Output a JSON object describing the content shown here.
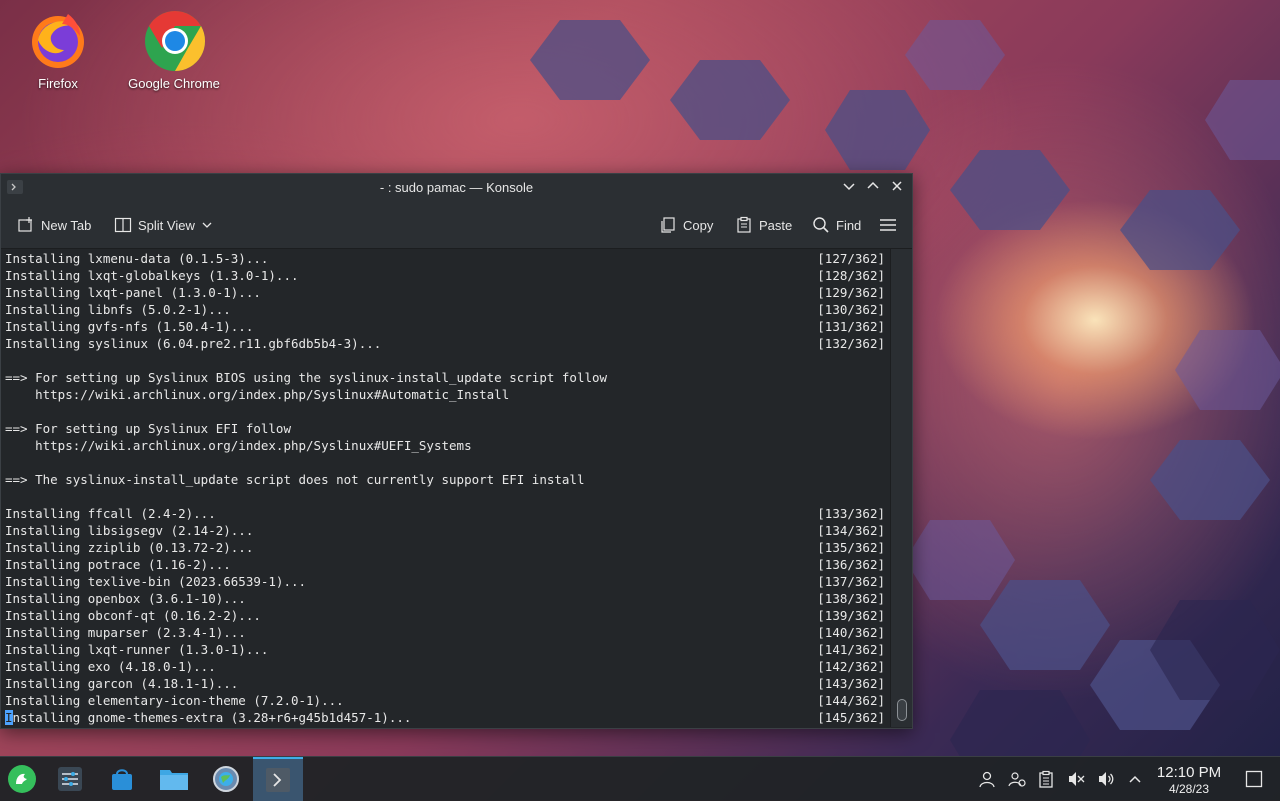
{
  "desktop": {
    "icons": [
      {
        "label": "Firefox"
      },
      {
        "label": "Google Chrome"
      }
    ]
  },
  "window": {
    "title": "- : sudo pamac — Konsole",
    "toolbar": {
      "new_tab": "New Tab",
      "split_view": "Split View",
      "copy": "Copy",
      "paste": "Paste",
      "find": "Find"
    }
  },
  "terminal": {
    "lines": [
      {
        "text": "Installing lxmenu-data (0.1.5-3)...",
        "progress": "[127/362]"
      },
      {
        "text": "Installing lxqt-globalkeys (1.3.0-1)...",
        "progress": "[128/362]"
      },
      {
        "text": "Installing lxqt-panel (1.3.0-1)...",
        "progress": "[129/362]"
      },
      {
        "text": "Installing libnfs (5.0.2-1)...",
        "progress": "[130/362]"
      },
      {
        "text": "Installing gvfs-nfs (1.50.4-1)...",
        "progress": "[131/362]"
      },
      {
        "text": "Installing syslinux (6.04.pre2.r11.gbf6db5b4-3)...",
        "progress": "[132/362]"
      },
      {
        "text": "",
        "progress": ""
      },
      {
        "text": "==> For setting up Syslinux BIOS using the syslinux-install_update script follow",
        "progress": ""
      },
      {
        "text": "    https://wiki.archlinux.org/index.php/Syslinux#Automatic_Install",
        "progress": ""
      },
      {
        "text": "",
        "progress": ""
      },
      {
        "text": "==> For setting up Syslinux EFI follow",
        "progress": ""
      },
      {
        "text": "    https://wiki.archlinux.org/index.php/Syslinux#UEFI_Systems",
        "progress": ""
      },
      {
        "text": "",
        "progress": ""
      },
      {
        "text": "==> The syslinux-install_update script does not currently support EFI install",
        "progress": ""
      },
      {
        "text": "",
        "progress": ""
      },
      {
        "text": "Installing ffcall (2.4-2)...",
        "progress": "[133/362]"
      },
      {
        "text": "Installing libsigsegv (2.14-2)...",
        "progress": "[134/362]"
      },
      {
        "text": "Installing zziplib (0.13.72-2)...",
        "progress": "[135/362]"
      },
      {
        "text": "Installing potrace (1.16-2)...",
        "progress": "[136/362]"
      },
      {
        "text": "Installing texlive-bin (2023.66539-1)...",
        "progress": "[137/362]"
      },
      {
        "text": "Installing openbox (3.6.1-10)...",
        "progress": "[138/362]"
      },
      {
        "text": "Installing obconf-qt (0.16.2-2)...",
        "progress": "[139/362]"
      },
      {
        "text": "Installing muparser (2.3.4-1)...",
        "progress": "[140/362]"
      },
      {
        "text": "Installing lxqt-runner (1.3.0-1)...",
        "progress": "[141/362]"
      },
      {
        "text": "Installing exo (4.18.0-1)...",
        "progress": "[142/362]"
      },
      {
        "text": "Installing garcon (4.18.1-1)...",
        "progress": "[143/362]"
      },
      {
        "text": "Installing elementary-icon-theme (7.2.0-1)...",
        "progress": "[144/362]"
      },
      {
        "text": "Installing gnome-themes-extra (3.28+r6+g45b1d457-1)...",
        "progress": "[145/362]"
      }
    ]
  },
  "clock": {
    "time": "12:10 PM",
    "date": "4/28/23"
  },
  "colors": {
    "accent": "#3daee9",
    "terminal_bg": "#232629",
    "terminal_fg": "#e8e8e8"
  }
}
